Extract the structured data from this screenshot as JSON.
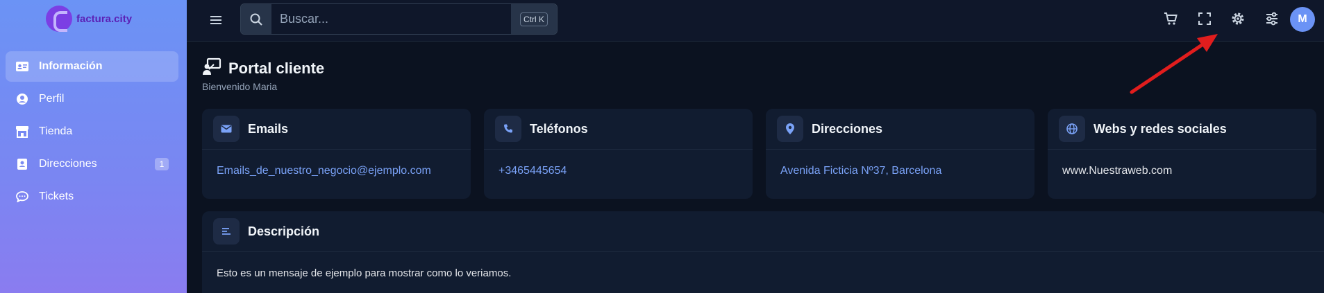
{
  "brand": {
    "name": "factura.city"
  },
  "sidebar": {
    "items": [
      {
        "label": "Información",
        "icon": "id-card-icon",
        "active": true
      },
      {
        "label": "Perfil",
        "icon": "user-circle-icon"
      },
      {
        "label": "Tienda",
        "icon": "store-icon"
      },
      {
        "label": "Direcciones",
        "icon": "address-book-icon",
        "badge": "1"
      },
      {
        "label": "Tickets",
        "icon": "chat-icon"
      }
    ]
  },
  "topbar": {
    "search_placeholder": "Buscar...",
    "shortcut": "Ctrl K",
    "icons": [
      "cart-icon",
      "fullscreen-icon",
      "gear-icon",
      "sliders-icon"
    ],
    "avatar_initial": "M"
  },
  "page": {
    "title": "Portal cliente",
    "subtitle": "Bienvenido Maria"
  },
  "cards": [
    {
      "title": "Emails",
      "icon": "envelope-icon",
      "value": "Emails_de_nuestro_negocio@ejemplo.com"
    },
    {
      "title": "Teléfonos",
      "icon": "phone-icon",
      "value": "+3465445654"
    },
    {
      "title": "Direcciones",
      "icon": "map-pin-icon",
      "value": "Avenida Ficticia Nº37, Barcelona"
    },
    {
      "title": "Webs y redes sociales",
      "icon": "globe-icon",
      "value": "www.Nuestraweb.com"
    }
  ],
  "description": {
    "title": "Descripción",
    "icon": "align-left-icon",
    "text": "Esto es un mensaje de ejemplo para mostrar como lo veriamos."
  },
  "colors": {
    "accent": "#7aa2f7",
    "annotation_arrow": "#e11d1d"
  }
}
